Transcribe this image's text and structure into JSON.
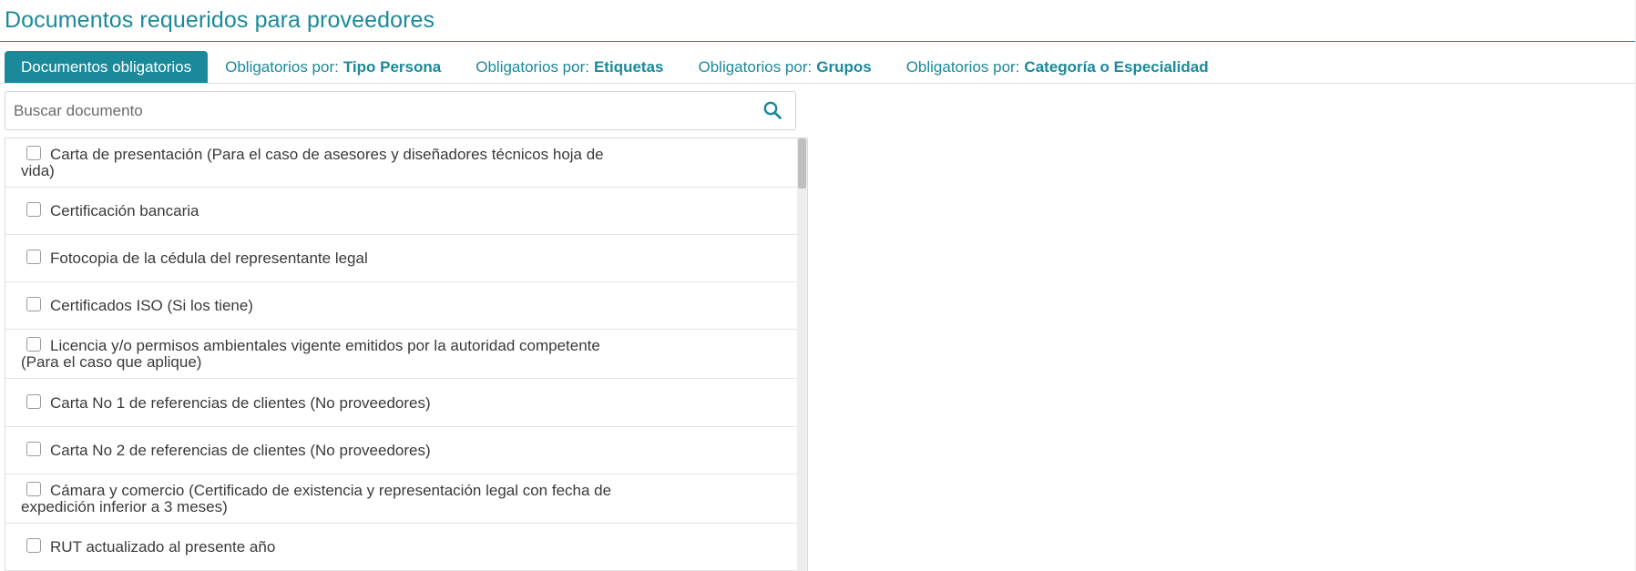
{
  "page": {
    "title": "Documentos requeridos para proveedores",
    "accent_color": "#1a8a9a"
  },
  "tabs": [
    {
      "label": "Documentos obligatorios",
      "bold": "",
      "active": true
    },
    {
      "label": "Obligatorios por:",
      "bold": "Tipo Persona",
      "active": false
    },
    {
      "label": "Obligatorios por:",
      "bold": "Etiquetas",
      "active": false
    },
    {
      "label": "Obligatorios por:",
      "bold": "Grupos",
      "active": false
    },
    {
      "label": "Obligatorios por:",
      "bold": "Categoría o Especialidad",
      "active": false
    }
  ],
  "search": {
    "placeholder": "Buscar documento",
    "value": "",
    "icon": "search-icon"
  },
  "documents": [
    {
      "label": "Carta de presentación (Para el caso de asesores y diseñadores técnicos hoja de vida)",
      "checked": false
    },
    {
      "label": "Certificación bancaria",
      "checked": false
    },
    {
      "label": "Fotocopia de la cédula del representante legal",
      "checked": false
    },
    {
      "label": "Certificados ISO (Si los tiene)",
      "checked": false
    },
    {
      "label": "Licencia y/o permisos ambientales vigente emitidos por la autoridad competente (Para el caso que aplique)",
      "checked": false
    },
    {
      "label": "Carta No 1 de referencias de clientes (No proveedores)",
      "checked": false
    },
    {
      "label": "Carta No 2 de referencias de clientes (No proveedores)",
      "checked": false
    },
    {
      "label": "Cámara y comercio (Certificado de existencia y representación legal con fecha de expedición inferior a 3 meses)",
      "checked": false
    },
    {
      "label": "RUT actualizado al presente año",
      "checked": false
    }
  ]
}
